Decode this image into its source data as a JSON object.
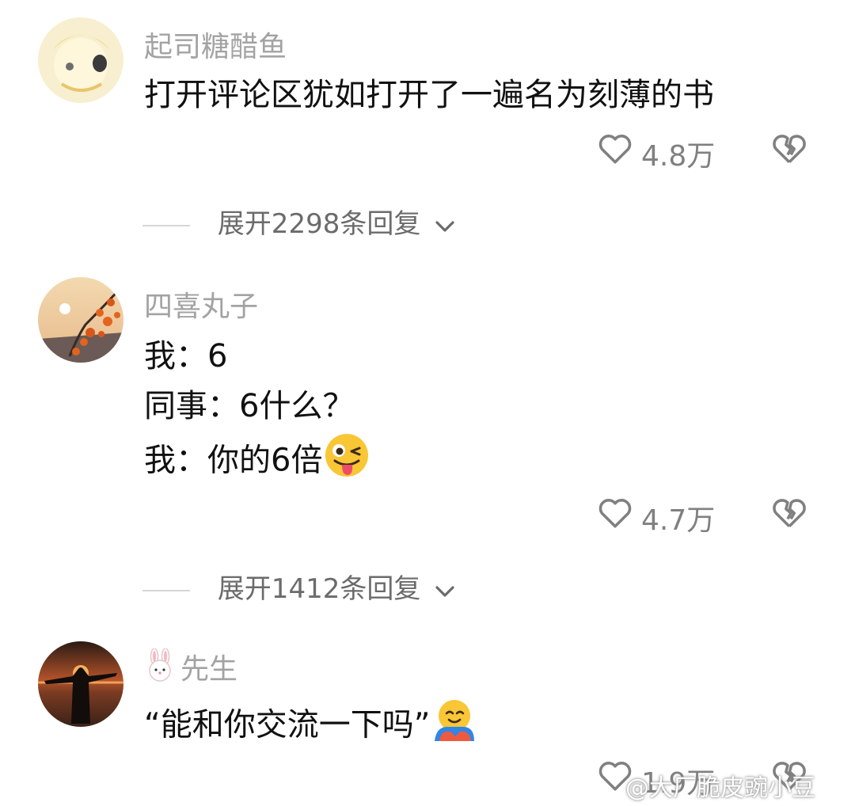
{
  "comments": [
    {
      "username": "起司糖醋鱼",
      "lines": [
        "打开评论区犹如打开了一遍名为刻薄的书"
      ],
      "likes": "4.8万",
      "expand_label": "展开2298条回复"
    },
    {
      "username": "四喜丸子",
      "lines": [
        "我：6",
        "同事：6什么？",
        "我：你的6倍"
      ],
      "likes": "4.7万",
      "expand_label": "展开1412条回复"
    },
    {
      "username": "先生",
      "lines": [
        "“能和你交流一下吗”"
      ],
      "likes": "1.9万"
    }
  ],
  "watermark": "@大厂脆皮豌小豆",
  "colors": {
    "username": "#a3a3a3",
    "text": "#111111",
    "meta": "#808080"
  }
}
